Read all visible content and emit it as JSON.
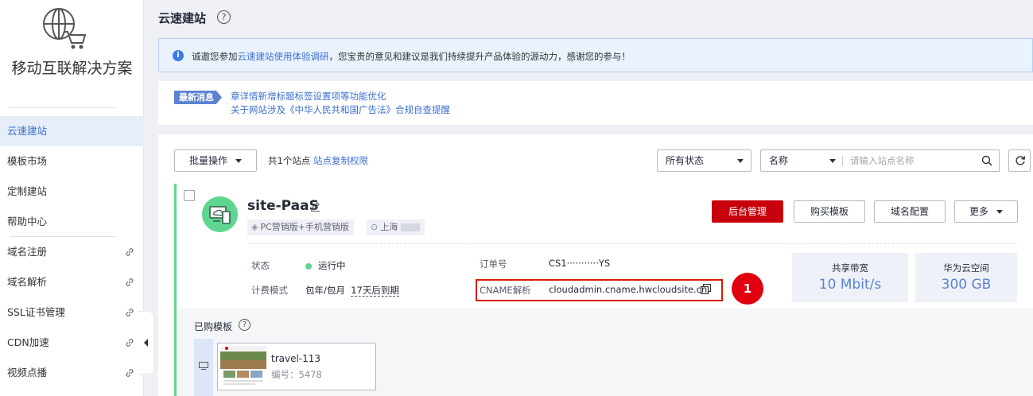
{
  "sidebar": {
    "app_title": "移动互联解决方案",
    "items": [
      {
        "label": "云速建站",
        "active": true,
        "external": false
      },
      {
        "label": "模板市场",
        "external": false
      },
      {
        "label": "定制建站",
        "external": false
      },
      {
        "label": "帮助中心",
        "external": false
      },
      {
        "label": "域名注册",
        "external": true
      },
      {
        "label": "域名解析",
        "external": true
      },
      {
        "label": "SSL证书管理",
        "external": true
      },
      {
        "label": "CDN加速",
        "external": true
      },
      {
        "label": "视频点播",
        "external": true
      }
    ]
  },
  "header": {
    "title": "云速建站",
    "help_glyph": "?"
  },
  "notice": {
    "info_glyph": "i",
    "prefix": "诚邀您参加",
    "link": "云速建站使用体验调研",
    "suffix": "，您宝贵的意见和建议是我们持续提升产品体验的源动力，感谢您的参与！"
  },
  "news": {
    "badge": "最新消息",
    "items": [
      "章详情新增标题标签设置项等功能优化",
      "关于网站涉及《中华人民共和国广告法》合规自查提醒"
    ]
  },
  "toolbar": {
    "batch_label": "批量操作",
    "count_text": "共1个站点",
    "copy_perm_link": "站点复制权限",
    "status_select": "所有状态",
    "field_select": "名称",
    "search_placeholder": "请输入站点名称"
  },
  "site": {
    "name": "site-PaaS",
    "tag_version": "PC营销版+手机营销版",
    "tag_region": "上海",
    "buttons": {
      "admin": "后台管理",
      "buy_template": "购买模板",
      "domain_config": "域名配置",
      "more": "更多"
    },
    "status_label": "状态",
    "status_value": "运行中",
    "billing_label": "计费模式",
    "billing_value": "包年/包月",
    "expire_value": "17天后到期",
    "order_label": "订单号",
    "order_value": "CS1···········YS",
    "cname_label": "CNAME解析",
    "cname_value": "cloudadmin.cname.hwcloudsite.cn",
    "callout_number": "1",
    "stats": [
      {
        "title": "共享带宽",
        "value": "10 Mbit/s"
      },
      {
        "title": "华为云空间",
        "value": "300 GB"
      }
    ],
    "purchased_label": "已购模板",
    "template": {
      "name": "travel-113",
      "code": "编号：5478"
    }
  },
  "colors": {
    "primary_red": "#c7000b",
    "accent_blue": "#3b6fd0",
    "status_green": "#5fd68f",
    "callout_red": "#e1000f"
  }
}
